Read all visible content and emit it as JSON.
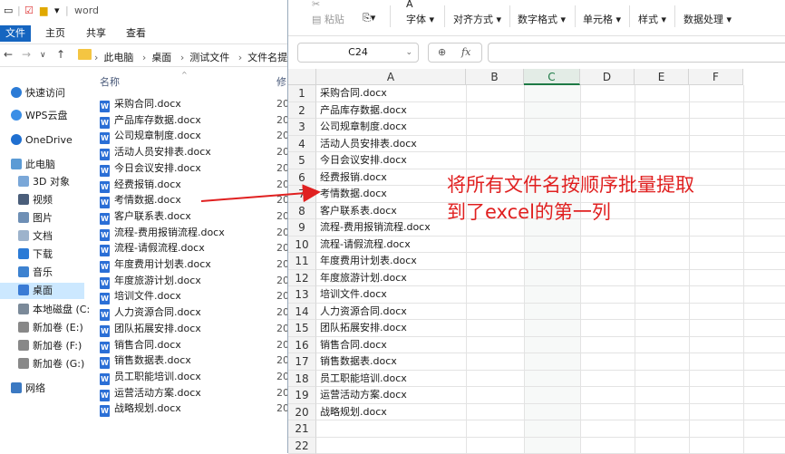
{
  "explorer": {
    "title": "word",
    "tabs": [
      "文件",
      "主页",
      "共享",
      "查看"
    ],
    "breadcrumb": [
      "此电脑",
      "桌面",
      "测试文件",
      "文件名提取"
    ],
    "nav_items": [
      "快速访问",
      "WPS云盘",
      "OneDrive",
      "此电脑",
      "3D 对象",
      "视频",
      "图片",
      "文档",
      "下载",
      "音乐",
      "桌面",
      "本地磁盘 (C:",
      "新加卷 (E:)",
      "新加卷 (F:)",
      "新加卷 (G:)",
      "网络"
    ],
    "col_name": "名称",
    "col_date": "修",
    "date_prefix": "20",
    "files": [
      "采购合同.docx",
      "产品库存数据.docx",
      "公司规章制度.docx",
      "活动人员安排表.docx",
      "今日会议安排.docx",
      "经费报销.docx",
      "考情数据.docx",
      "客户联系表.docx",
      "流程-费用报销流程.docx",
      "流程-请假流程.docx",
      "年度费用计划表.docx",
      "年度旅游计划.docx",
      "培训文件.docx",
      "人力资源合同.docx",
      "团队拓展安排.docx",
      "销售合同.docx",
      "销售数据表.docx",
      "员工职能培训.docx",
      "运营活动方案.docx",
      "战略规划.docx"
    ]
  },
  "excel": {
    "ribbon": {
      "paste": "粘贴",
      "font": "字体",
      "align": "对齐方式",
      "number": "数字格式",
      "cells": "单元格",
      "style": "样式",
      "data": "数据处理"
    },
    "name_box": "C24",
    "fx": "fx",
    "columns": [
      "A",
      "B",
      "C",
      "D",
      "E",
      "F"
    ],
    "selected_column": "C",
    "row_numbers": [
      "1",
      "2",
      "3",
      "4",
      "5",
      "6",
      "7",
      "8",
      "9",
      "10",
      "11",
      "12",
      "13",
      "14",
      "15",
      "16",
      "17",
      "18",
      "19",
      "20",
      "21",
      "22"
    ],
    "cells_a": [
      "采购合同.docx",
      "产品库存数据.docx",
      "公司规章制度.docx",
      "活动人员安排表.docx",
      "今日会议安排.docx",
      "经费报销.docx",
      "考情数据.docx",
      "客户联系表.docx",
      "流程-费用报销流程.docx",
      "流程-请假流程.docx",
      "年度费用计划表.docx",
      "年度旅游计划.docx",
      "培训文件.docx",
      "人力资源合同.docx",
      "团队拓展安排.docx",
      "销售合同.docx",
      "销售数据表.docx",
      "员工职能培训.docx",
      "运营活动方案.docx",
      "战略规划.docx",
      "",
      ""
    ]
  },
  "annotation": {
    "line1": "将所有文件名按顺序批量提取",
    "line2": "到了excel的第一列",
    "color": "#e02020"
  }
}
